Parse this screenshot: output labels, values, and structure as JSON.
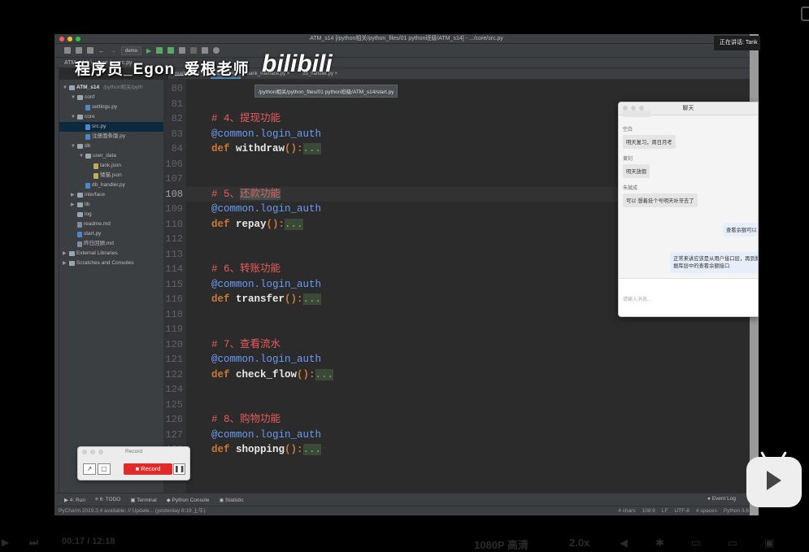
{
  "window": {
    "title": "ATM_s14 [/python相关/python_files/01 python班级/ATM_s14] - .../core/src.py",
    "run_config": "demo"
  },
  "navbar": {
    "breadcrumb": "ATM_s14  〉  core  〉  src.py"
  },
  "tabs": [
    "readme.md",
    "src.py",
    "bank_interface.py",
    "db_handler.py"
  ],
  "tooltip": "/python相关/python_files/01 python班级/ATM_s14/start.py",
  "project_tree": [
    {
      "label": "ATM_s14",
      "note": "/python相关/pyth",
      "indent": 0,
      "arrow": "▼",
      "icon": "folder",
      "bold": true
    },
    {
      "label": "conf",
      "indent": 1,
      "arrow": "▼",
      "icon": "folder"
    },
    {
      "label": "settings.py",
      "indent": 2,
      "icon": "py"
    },
    {
      "label": "core",
      "indent": 1,
      "arrow": "▼",
      "icon": "folder"
    },
    {
      "label": "src.py",
      "indent": 2,
      "icon": "py",
      "selected": true
    },
    {
      "label": "注册面条版.py",
      "indent": 2,
      "icon": "py"
    },
    {
      "label": "db",
      "indent": 1,
      "arrow": "▼",
      "icon": "folder"
    },
    {
      "label": "user_data",
      "indent": 2,
      "arrow": "▼",
      "icon": "folder"
    },
    {
      "label": "tank.json",
      "indent": 3,
      "icon": "json"
    },
    {
      "label": "矮猫.json",
      "indent": 3,
      "icon": "json"
    },
    {
      "label": "db_handler.py",
      "indent": 2,
      "icon": "py"
    },
    {
      "label": "interface",
      "indent": 1,
      "arrow": "▶",
      "icon": "folder"
    },
    {
      "label": "lib",
      "indent": 1,
      "arrow": "▶",
      "icon": "folder"
    },
    {
      "label": "log",
      "indent": 1,
      "icon": "folder"
    },
    {
      "label": "readme.md",
      "indent": 1,
      "icon": "md"
    },
    {
      "label": "start.py",
      "indent": 1,
      "icon": "py"
    },
    {
      "label": "昨日回顾.md",
      "indent": 1,
      "icon": "md"
    },
    {
      "label": "External Libraries",
      "indent": 0,
      "arrow": "▶",
      "icon": "folder"
    },
    {
      "label": "Scratches and Consoles",
      "indent": 0,
      "arrow": "▶",
      "icon": "folder"
    }
  ],
  "code_lines": [
    {
      "no": "80",
      "segs": []
    },
    {
      "no": "81",
      "segs": []
    },
    {
      "no": "82",
      "segs": [
        {
          "t": "# 4、提现功能",
          "c": "cmt"
        }
      ]
    },
    {
      "no": "83",
      "segs": [
        {
          "t": "@common.login_auth",
          "c": "dec"
        }
      ]
    },
    {
      "no": "84",
      "segs": [
        {
          "t": "def ",
          "c": "kw"
        },
        {
          "t": "withdraw",
          "c": "fn"
        },
        {
          "t": "():",
          "c": "kw"
        },
        {
          "t": "...",
          "c": "dots"
        }
      ]
    },
    {
      "no": "106",
      "segs": []
    },
    {
      "no": "107",
      "segs": []
    },
    {
      "no": "108",
      "segs": [
        {
          "t": "# 5、",
          "c": "cmt"
        },
        {
          "t": "还款功能",
          "c": "hlf"
        }
      ],
      "current": true
    },
    {
      "no": "109",
      "segs": [
        {
          "t": "@common.login_auth",
          "c": "dec"
        }
      ]
    },
    {
      "no": "110",
      "segs": [
        {
          "t": "def ",
          "c": "kw"
        },
        {
          "t": "repay",
          "c": "fn"
        },
        {
          "t": "():",
          "c": "kw"
        },
        {
          "t": "...",
          "c": "dots"
        }
      ]
    },
    {
      "no": "112",
      "segs": []
    },
    {
      "no": "113",
      "segs": []
    },
    {
      "no": "114",
      "segs": [
        {
          "t": "# 6、转账功能",
          "c": "cmt"
        }
      ]
    },
    {
      "no": "115",
      "segs": [
        {
          "t": "@common.login_auth",
          "c": "dec"
        }
      ]
    },
    {
      "no": "116",
      "segs": [
        {
          "t": "def ",
          "c": "kw"
        },
        {
          "t": "transfer",
          "c": "fn"
        },
        {
          "t": "():",
          "c": "kw"
        },
        {
          "t": "...",
          "c": "dots"
        }
      ]
    },
    {
      "no": "118",
      "segs": []
    },
    {
      "no": "119",
      "segs": []
    },
    {
      "no": "120",
      "segs": [
        {
          "t": "# 7、查看流水",
          "c": "cmt"
        }
      ]
    },
    {
      "no": "121",
      "segs": [
        {
          "t": "@common.login_auth",
          "c": "dec"
        }
      ]
    },
    {
      "no": "122",
      "segs": [
        {
          "t": "def ",
          "c": "kw"
        },
        {
          "t": "check_flow",
          "c": "fn"
        },
        {
          "t": "():",
          "c": "kw"
        },
        {
          "t": "...",
          "c": "dots"
        }
      ]
    },
    {
      "no": "124",
      "segs": []
    },
    {
      "no": "125",
      "segs": []
    },
    {
      "no": "126",
      "segs": [
        {
          "t": "# 8、购物功能",
          "c": "cmt"
        }
      ]
    },
    {
      "no": "127",
      "segs": [
        {
          "t": "@common.login_auth",
          "c": "dec"
        }
      ]
    },
    {
      "no": "128",
      "segs": [
        {
          "t": "def ",
          "c": "kw"
        },
        {
          "t": "shopping",
          "c": "fn"
        },
        {
          "t": "():",
          "c": "kw"
        },
        {
          "t": "...",
          "c": "dots"
        }
      ]
    }
  ],
  "bottom_tools": [
    "▶ 4: Run",
    "≡ 6: TODO",
    "▣ Terminal",
    "◆ Python Console",
    "◉ Statistic"
  ],
  "event_log": "● Event Log",
  "status": {
    "message": "PyCharm 2019.3.4 available: // Update... (yesterday 8:19 上午)",
    "right": [
      "4 chars",
      "108:9",
      "LF",
      "UTF-8",
      "4 spaces",
      "Python 3.6"
    ]
  },
  "watermark": {
    "text": "程序员_Egon_爱根老师",
    "logo": "bilibili"
  },
  "speaking": "正在讲话: Tank",
  "chat": {
    "title": "聊天",
    "messages": [
      {
        "name": "空白",
        "text": "明天复习，周日月考"
      },
      {
        "name": "黄钊",
        "text": "明天放假"
      },
      {
        "name": "朱斌成",
        "text": "可以 想着挂个号明天补牙去了"
      }
    ],
    "my_messages": [
      "查看余额可以",
      "正常来讲应该是从用户接口层，再到数据库层中的查看余额接口"
    ],
    "input_placeholder": "请输入消息..."
  },
  "recorder": {
    "title": "Record",
    "record_label": "Record"
  },
  "player": {
    "time": "00:17 / 12:18",
    "quality": "1080P 高清",
    "speed": "2.0x"
  }
}
